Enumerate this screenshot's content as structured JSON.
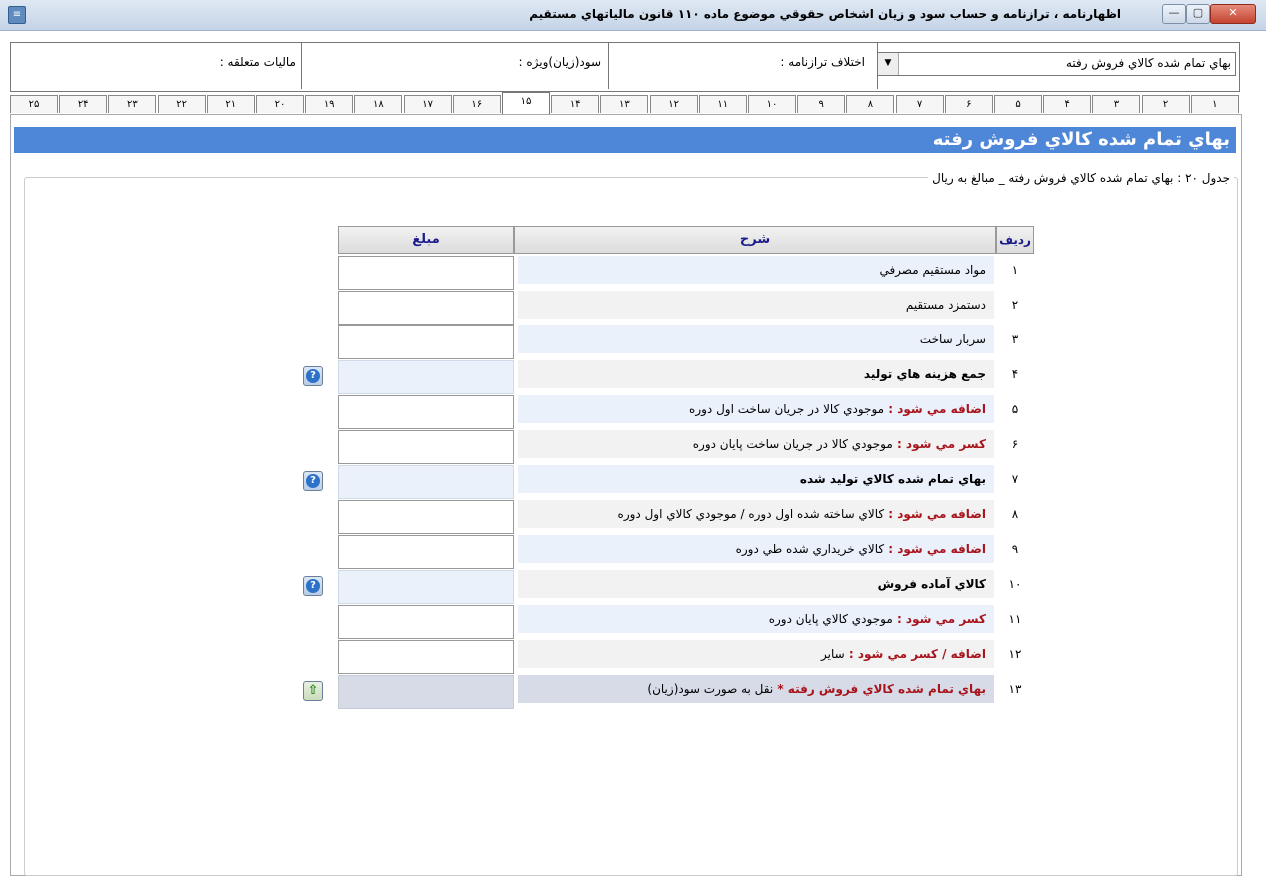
{
  "window": {
    "title": "اظهارنامه ، ترازنامه و حساب سود و زيان اشخاص حقوقي موضوع ماده ۱۱۰ قانون مالياتهاي مستقيم",
    "minimize_glyph": "—",
    "maximize_glyph": "▢",
    "close_glyph": "✕"
  },
  "header": {
    "combo_value": "بهاي تمام شده كالاي فروش رفته",
    "combo_arrow": "▼",
    "balance_diff_label": "اختلاف ترازنامه :",
    "profit_label": "سود(زيان)ويژه :",
    "tax_label": "ماليات متعلقه :"
  },
  "tabs": [
    "۱",
    "۲",
    "۳",
    "۴",
    "۵",
    "۶",
    "۷",
    "۸",
    "۹",
    "۱۰",
    "۱۱",
    "۱۲",
    "۱۳",
    "۱۴",
    "۱۵",
    "۱۶",
    "۱۷",
    "۱۸",
    "۱۹",
    "۲۰",
    "۲۱",
    "۲۲",
    "۲۳",
    "۲۴",
    "۲۵"
  ],
  "active_tab_index": 14,
  "section": {
    "title": "بهاي تمام شده كالاي فروش رفته",
    "table_caption": "جدول ۲۰ : بهاي تمام شده كالاي فروش رفته _ مبالغ به ريال"
  },
  "table": {
    "col_row": "رديف",
    "col_desc": "شرح",
    "col_amount": "مبلغ",
    "help_glyph": "?",
    "up_glyph": "⇧",
    "rows": [
      {
        "num": "۱",
        "prefix": "",
        "desc": "مواد مستقيم مصرفي"
      },
      {
        "num": "۲",
        "prefix": "",
        "desc": "دستمزد مستقيم"
      },
      {
        "num": "۳",
        "prefix": "",
        "desc": "سربار ساخت"
      },
      {
        "num": "۴",
        "prefix": "",
        "desc": "جمع هزينه هاي توليد"
      },
      {
        "num": "۵",
        "prefix": "اضافه مي شود :",
        "desc": "موجودي كالا در جريان ساخت اول دوره"
      },
      {
        "num": "۶",
        "prefix": "كسر مي شود :",
        "desc": "موجودي كالا در جريان ساخت پايان دوره"
      },
      {
        "num": "۷",
        "prefix": "",
        "desc": "بهاي تمام شده كالاي توليد شده"
      },
      {
        "num": "۸",
        "prefix": "اضافه مي شود :",
        "desc": "كالاي ساخته شده اول دوره / موجودي كالاي اول دوره"
      },
      {
        "num": "۹",
        "prefix": "اضافه مي شود :",
        "desc": "كالاي خريداري شده طي دوره"
      },
      {
        "num": "۱۰",
        "prefix": "",
        "desc": "كالاي آماده فروش"
      },
      {
        "num": "۱۱",
        "prefix": "كسر مي شود :",
        "desc": "موجودي كالاي پايان دوره"
      },
      {
        "num": "۱۲",
        "prefix": "اضافه / كسر مي شود :",
        "desc": "ساير"
      },
      {
        "num": "۱۳",
        "prefix": "بهاي تمام شده كالاي فروش رفته *",
        "desc": "نقل به صورت سود(زيان)"
      }
    ]
  }
}
